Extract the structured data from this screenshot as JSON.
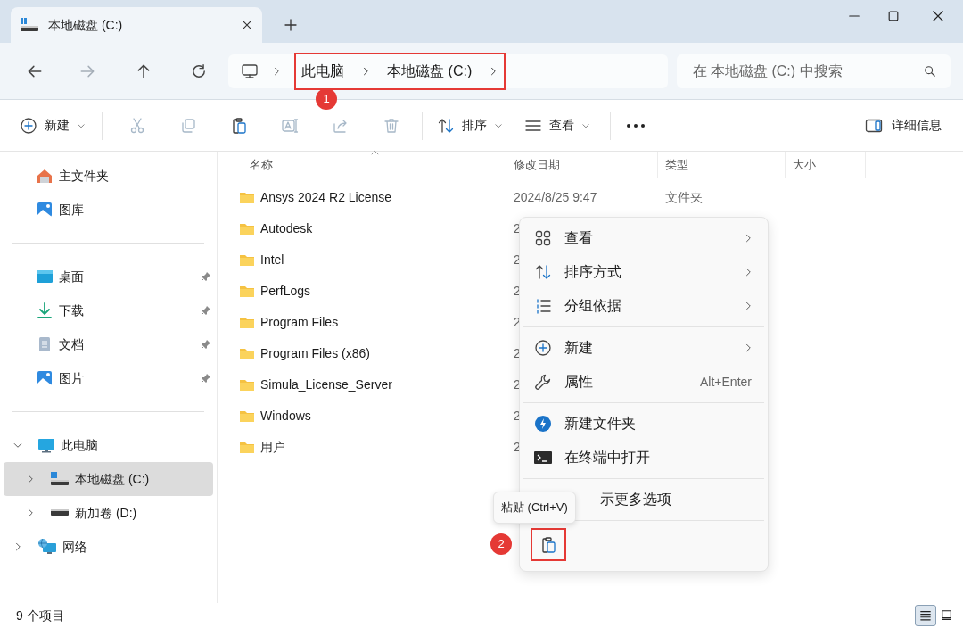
{
  "tab": {
    "title": "本地磁盘 (C:)"
  },
  "address": {
    "crumbs": [
      "此电脑",
      "本地磁盘 (C:)"
    ],
    "marker": "1"
  },
  "search": {
    "placeholder": "在 本地磁盘 (C:) 中搜索"
  },
  "toolbar": {
    "new_label": "新建",
    "actions": [
      {
        "kind": "cut",
        "disabled": true
      },
      {
        "kind": "copy",
        "disabled": true
      },
      {
        "kind": "paste",
        "disabled": false
      },
      {
        "kind": "rename",
        "disabled": true
      },
      {
        "kind": "share",
        "disabled": true
      },
      {
        "kind": "delete",
        "disabled": true
      }
    ],
    "sort_label": "排序",
    "view_label": "查看",
    "details_label": "详细信息"
  },
  "sidebar": {
    "quick": [
      {
        "kind": "home",
        "label": "主文件夹"
      },
      {
        "kind": "gallery",
        "label": "图库"
      }
    ],
    "pinned": [
      {
        "kind": "desktop",
        "label": "桌面",
        "pinned": true
      },
      {
        "kind": "download",
        "label": "下载",
        "pinned": true
      },
      {
        "kind": "document",
        "label": "文档",
        "pinned": true
      },
      {
        "kind": "picture",
        "label": "图片",
        "pinned": true
      }
    ],
    "tree": [
      {
        "kind": "pc",
        "label": "此电脑",
        "expanded": true,
        "selected": false,
        "children": [
          {
            "kind": "system-drive",
            "label": "本地磁盘 (C:)",
            "expanded": false,
            "selected": true
          },
          {
            "kind": "drive",
            "label": "新加卷 (D:)",
            "expanded": false,
            "selected": false
          }
        ]
      },
      {
        "kind": "network",
        "label": "网络",
        "expanded": false,
        "selected": false
      }
    ]
  },
  "table": {
    "columns": [
      "名称",
      "修改日期",
      "类型",
      "大小"
    ],
    "rows": [
      {
        "name": "Ansys 2024 R2 License",
        "date": "2024/8/25 9:47",
        "type": "文件夹"
      },
      {
        "name": "Autodesk",
        "date": "2"
      },
      {
        "name": "Intel",
        "date": "2"
      },
      {
        "name": "PerfLogs",
        "date": "2"
      },
      {
        "name": "Program Files",
        "date": "2"
      },
      {
        "name": "Program Files (x86)",
        "date": "2"
      },
      {
        "name": "Simula_License_Server",
        "date": "2"
      },
      {
        "name": "Windows",
        "date": "2"
      },
      {
        "name": "用户",
        "date": "2"
      }
    ]
  },
  "context_menu": {
    "groups": [
      [
        {
          "kind": "view",
          "label": "查看",
          "submenu": true
        },
        {
          "kind": "sort",
          "label": "排序方式",
          "submenu": true
        },
        {
          "kind": "group",
          "label": "分组依据",
          "submenu": true
        }
      ],
      [
        {
          "kind": "new",
          "label": "新建",
          "submenu": true
        },
        {
          "kind": "properties",
          "label": "属性",
          "submenu": false,
          "shortcut": "Alt+Enter"
        }
      ],
      [
        {
          "kind": "new-folder",
          "label": "新建文件夹",
          "submenu": false
        },
        {
          "kind": "terminal",
          "label": "在终端中打开",
          "submenu": false
        }
      ],
      [
        {
          "kind": "more",
          "label": "示更多选项",
          "submenu": false
        }
      ]
    ],
    "paste_marker": "2"
  },
  "tooltip": "粘贴 (Ctrl+V)",
  "status_bar": {
    "count": "9 个项目",
    "views": [
      {
        "kind": "details",
        "selected": true
      },
      {
        "kind": "tiles",
        "selected": false
      }
    ]
  }
}
